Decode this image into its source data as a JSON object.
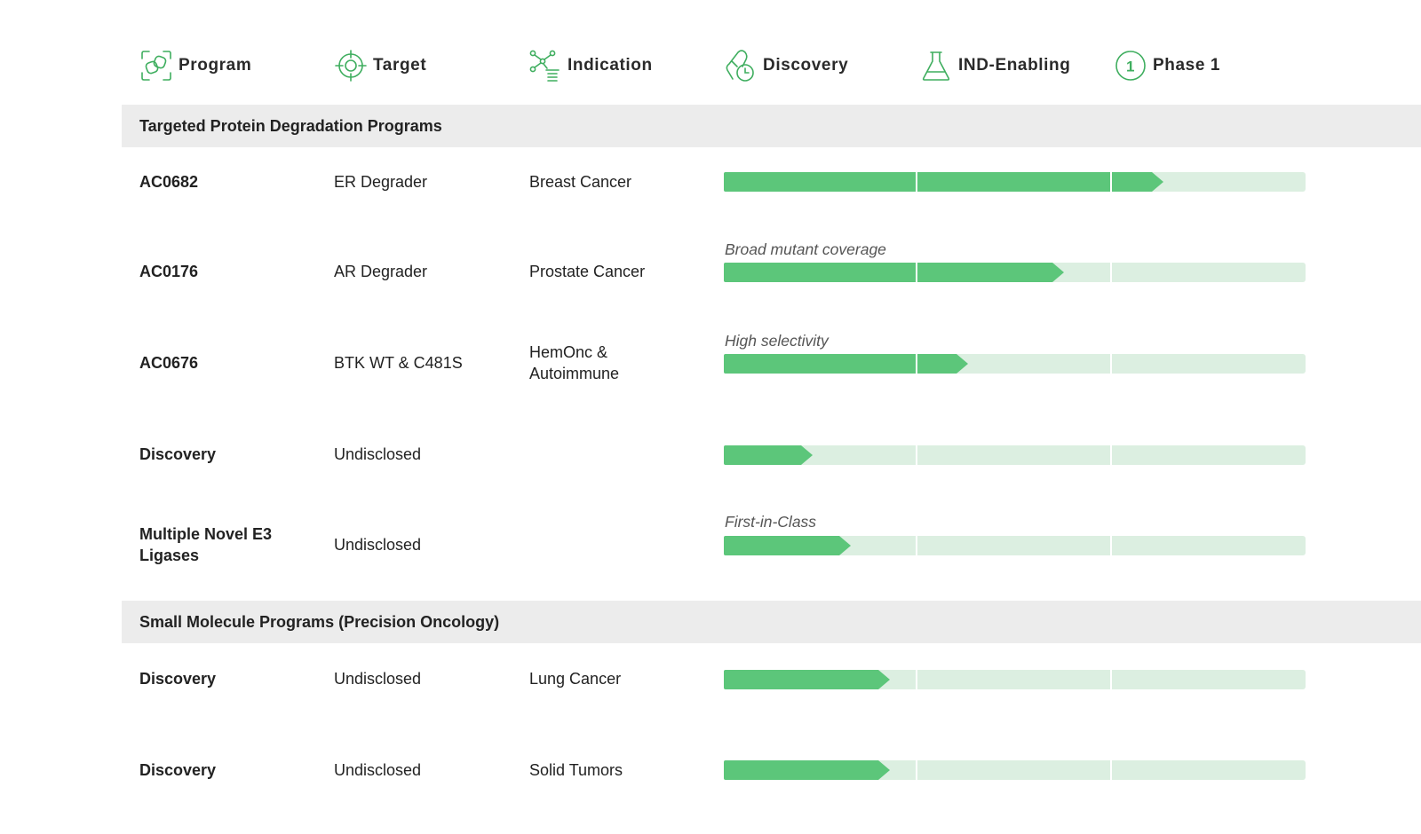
{
  "header": {
    "columns": [
      {
        "label": "Program",
        "icon": "program-icon"
      },
      {
        "label": "Target",
        "icon": "target-icon"
      },
      {
        "label": "Indication",
        "icon": "indication-icon"
      },
      {
        "label": "Discovery",
        "icon": "discovery-icon"
      },
      {
        "label": "IND-Enabling",
        "icon": "flask-icon"
      },
      {
        "label": "Phase 1",
        "icon": "phase-1-icon"
      }
    ],
    "phase1_icon_digit": "1"
  },
  "colors": {
    "accent": "#5cc67a",
    "track": "#dcefe1",
    "section_bg": "#ececec",
    "icon_stroke": "#3fae5f"
  },
  "sections": [
    {
      "title": "Targeted Protein Degradation Programs",
      "rows": [
        {
          "program": "AC0682",
          "target": "ER Degrader",
          "indication": "Breast Cancer",
          "note": "",
          "progress": 0.755
        },
        {
          "program": "AC0176",
          "target": "AR Degrader",
          "indication": "Prostate Cancer",
          "note": "Broad mutant coverage",
          "progress": 0.585
        },
        {
          "program": "AC0676",
          "target": "BTK WT & C481S",
          "indication": "HemOnc & Autoimmune",
          "note": "High selectivity",
          "progress": 0.42
        },
        {
          "program": "Discovery",
          "target": "Undisclosed",
          "indication": "",
          "note": "",
          "progress": 0.152
        },
        {
          "program": "Multiple Novel E3 Ligases",
          "target": "Undisclosed",
          "indication": "",
          "note": "First-in-Class",
          "progress": 0.218
        }
      ]
    },
    {
      "title": "Small Molecule Programs (Precision Oncology)",
      "rows": [
        {
          "program": "Discovery",
          "target": "Undisclosed",
          "indication": "Lung Cancer",
          "note": "",
          "progress": 0.285
        },
        {
          "program": "Discovery",
          "target": "Undisclosed",
          "indication": "Solid Tumors",
          "note": "",
          "progress": 0.285
        }
      ]
    }
  ]
}
